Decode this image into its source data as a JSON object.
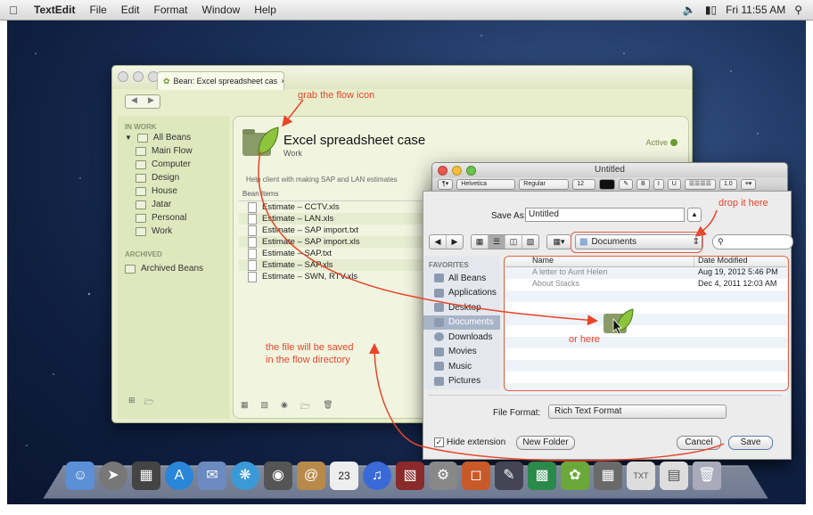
{
  "menubar": {
    "app": "TextEdit",
    "items": [
      "File",
      "Edit",
      "Format",
      "Window",
      "Help"
    ],
    "clock": "Fri 11:55 AM"
  },
  "bean": {
    "tab_title": "Bean: Excel spreadsheet cas",
    "in_work": "IN WORK",
    "all_beans": "All Beans",
    "flows": [
      "Main Flow",
      "Computer",
      "Design",
      "House",
      "Jatar",
      "Personal",
      "Work"
    ],
    "archived": "ARCHIVED",
    "archived_beans": "Archived Beans",
    "title": "Excel spreadsheet case",
    "subtitle": "Work",
    "status": "Active",
    "help": "Help client with making SAP and LAN estimates",
    "items_header": "Bean Items",
    "items": [
      "Estimate – CCTV.xls",
      "Estimate – LAN.xls",
      "Estimate – SAP import.txt",
      "Estimate – SAP import.xls",
      "Estimate – SAP.txt",
      "Estimate – SAP.xls",
      "Estimate – SWN, RTV.xls"
    ]
  },
  "textedit": {
    "title": "Untitled",
    "font": "Helvetica",
    "style": "Regular",
    "size": "12",
    "spacing": "1.0"
  },
  "save": {
    "save_as_label": "Save As:",
    "filename": "Untitled",
    "location": "Documents",
    "favorites_header": "FAVORITES",
    "favorites": [
      "All Beans",
      "Applications",
      "Desktop",
      "Documents",
      "Downloads",
      "Movies",
      "Music",
      "Pictures"
    ],
    "col_name": "Name",
    "col_date": "Date Modified",
    "files": [
      {
        "name": "A letter to Aunt Helen",
        "date": "Aug 19, 2012 5:46 PM"
      },
      {
        "name": "About Stacks",
        "date": "Dec 4, 2011 12:03 AM"
      }
    ],
    "format_label": "File Format:",
    "format": "Rich Text Format",
    "hide_ext": "Hide extension",
    "new_folder": "New Folder",
    "cancel": "Cancel",
    "save": "Save"
  },
  "annotations": {
    "grab": "grab the flow icon",
    "drop": "drop it here",
    "or": "or here",
    "saved1": "the file will be saved",
    "saved2": "in the flow directory"
  },
  "colors": {
    "annotation": "#e8452a",
    "bean_bg": "#e8eecc",
    "selection": "#a8b4c8"
  }
}
